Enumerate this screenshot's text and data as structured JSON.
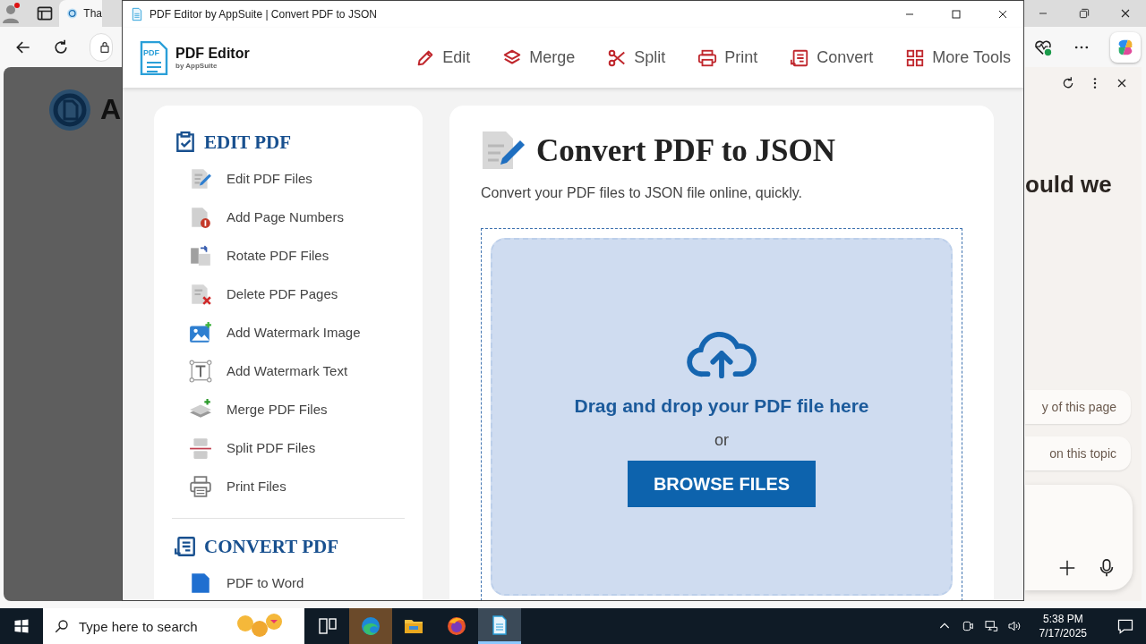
{
  "browser": {
    "tab_title": "Tha",
    "page_heading": "A",
    "copilot": {
      "heading": "ould we",
      "suggestions": [
        "y of this page",
        "on this topic"
      ]
    }
  },
  "app": {
    "title": "PDF Editor by AppSuite | Convert PDF to JSON",
    "logo": {
      "badge": "PDF",
      "name": "PDF Editor",
      "tagline": "by AppSuite"
    },
    "nav": [
      "Edit",
      "Merge",
      "Split",
      "Print",
      "Convert",
      "More Tools"
    ],
    "sidebar": [
      {
        "title": "EDIT PDF",
        "items": [
          "Edit PDF Files",
          "Add Page Numbers",
          "Rotate PDF Files",
          "Delete PDF Pages",
          "Add Watermark Image",
          "Add Watermark Text",
          "Merge PDF Files",
          "Split PDF Files",
          "Print Files"
        ]
      },
      {
        "title": "CONVERT PDF",
        "items": [
          "PDF to Word"
        ]
      }
    ],
    "main": {
      "heading": "Convert PDF to JSON",
      "subtitle": "Convert your PDF files to JSON file online, quickly.",
      "drop_text": "Drag and drop your PDF file here",
      "or": "or",
      "button": "BROWSE FILES"
    }
  },
  "taskbar": {
    "search_placeholder": "Type here to search",
    "apps": [
      {
        "kind": "taskview",
        "selected": false,
        "highlighted": false
      },
      {
        "kind": "edge",
        "selected": false,
        "highlighted": true
      },
      {
        "kind": "folder",
        "selected": false,
        "highlighted": false
      },
      {
        "kind": "firefox",
        "selected": false,
        "highlighted": false
      },
      {
        "kind": "pdf",
        "selected": true,
        "highlighted": false
      }
    ],
    "time": "5:38 PM",
    "date": "7/17/2025"
  }
}
